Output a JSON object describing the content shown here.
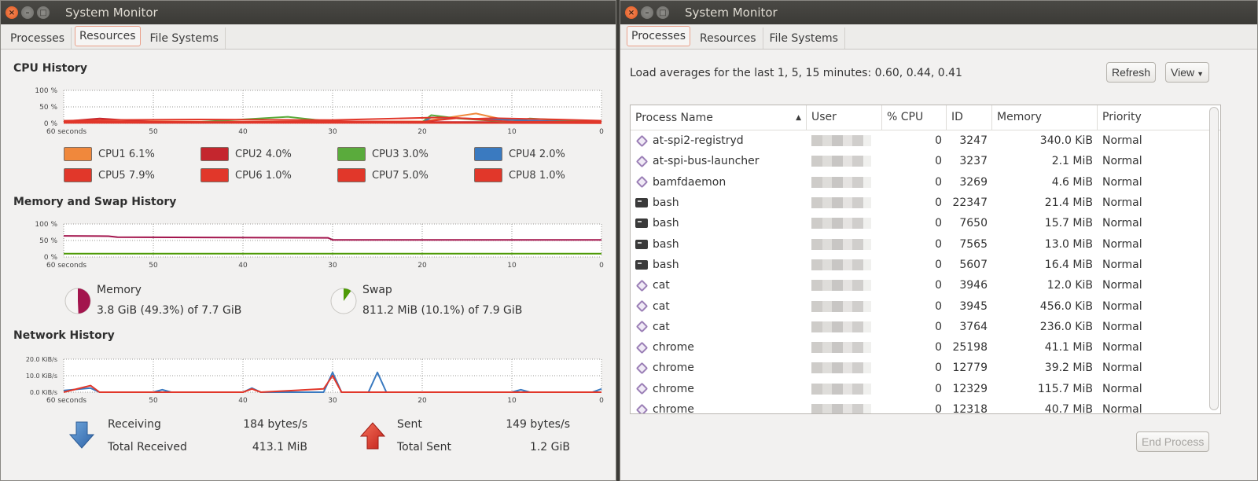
{
  "left_window": {
    "title": "System Monitor",
    "tabs": [
      {
        "label": "Processes",
        "active": false
      },
      {
        "label": "Resources",
        "active": true
      },
      {
        "label": "File Systems",
        "active": false
      }
    ],
    "cpu": {
      "title": "CPU History",
      "legend": [
        {
          "label": "CPU1",
          "value": "6.1%",
          "color": "#f0883c"
        },
        {
          "label": "CPU2",
          "value": "4.0%",
          "color": "#c4262e"
        },
        {
          "label": "CPU3",
          "value": "3.0%",
          "color": "#5aab3c"
        },
        {
          "label": "CPU4",
          "value": "2.0%",
          "color": "#3a7ac0"
        },
        {
          "label": "CPU5",
          "value": "7.9%",
          "color": "#e1372a"
        },
        {
          "label": "CPU6",
          "value": "1.0%",
          "color": "#e1372a"
        },
        {
          "label": "CPU7",
          "value": "5.0%",
          "color": "#e1372a"
        },
        {
          "label": "CPU8",
          "value": "1.0%",
          "color": "#e1372a"
        }
      ]
    },
    "memory": {
      "title": "Memory and Swap History",
      "memory_label": "Memory",
      "memory_value": "3.8 GiB (49.3%) of 7.7 GiB",
      "memory_fraction": 0.493,
      "memory_color": "#a3154d",
      "swap_label": "Swap",
      "swap_value": "811.2 MiB (10.1%) of 7.9 GiB",
      "swap_fraction": 0.101,
      "swap_color": "#4e9a06"
    },
    "network": {
      "title": "Network History",
      "receiving_label": "Receiving",
      "receiving_value": "184 bytes/s",
      "total_received_label": "Total Received",
      "total_received_value": "413.1 MiB",
      "sent_label": "Sent",
      "sent_value": "149 bytes/s",
      "total_sent_label": "Total Sent",
      "total_sent_value": "1.2 GiB",
      "receive_color": "#3a7ac0",
      "sent_color": "#e1372a"
    }
  },
  "chart_data": [
    {
      "type": "line",
      "title": "CPU History",
      "x_ticks": [
        "60 seconds",
        "50",
        "40",
        "30",
        "20",
        "10",
        "0"
      ],
      "y_ticks": [
        "100 %",
        "50 %",
        "0 %"
      ],
      "ylim": [
        0,
        100
      ],
      "x_range": [
        60,
        0
      ],
      "grid": true,
      "series": [
        {
          "name": "CPU1",
          "color": "#f0883c",
          "points": [
            [
              60,
              5
            ],
            [
              50,
              6
            ],
            [
              40,
              5
            ],
            [
              30,
              6
            ],
            [
              20,
              6
            ],
            [
              14,
              30
            ],
            [
              10,
              6
            ],
            [
              5,
              8
            ],
            [
              0,
              6
            ]
          ]
        },
        {
          "name": "CPU2",
          "color": "#c4262e",
          "points": [
            [
              60,
              6
            ],
            [
              56,
              15
            ],
            [
              50,
              4
            ],
            [
              40,
              4
            ],
            [
              30,
              6
            ],
            [
              20,
              4
            ],
            [
              0,
              4
            ]
          ]
        },
        {
          "name": "CPU3",
          "color": "#5aab3c",
          "points": [
            [
              60,
              4
            ],
            [
              50,
              3
            ],
            [
              45,
              4
            ],
            [
              35,
              20
            ],
            [
              30,
              5
            ],
            [
              20,
              4
            ],
            [
              19,
              25
            ],
            [
              16,
              15
            ],
            [
              10,
              4
            ],
            [
              8,
              15
            ],
            [
              0,
              3
            ]
          ]
        },
        {
          "name": "CPU4",
          "color": "#3a7ac0",
          "points": [
            [
              60,
              3
            ],
            [
              50,
              2
            ],
            [
              30,
              3
            ],
            [
              20,
              2
            ],
            [
              19,
              18
            ],
            [
              0,
              2
            ]
          ]
        },
        {
          "name": "CPU5",
          "color": "#e1372a",
          "points": [
            [
              60,
              8
            ],
            [
              56,
              10
            ],
            [
              45,
              12
            ],
            [
              30,
              10
            ],
            [
              18,
              18
            ],
            [
              14,
              14
            ],
            [
              12,
              16
            ],
            [
              5,
              12
            ],
            [
              0,
              8
            ]
          ]
        },
        {
          "name": "CPU6",
          "color": "#e1372a",
          "points": [
            [
              60,
              2
            ],
            [
              30,
              2
            ],
            [
              0,
              1
            ]
          ]
        },
        {
          "name": "CPU7",
          "color": "#e1372a",
          "points": [
            [
              60,
              6
            ],
            [
              50,
              5
            ],
            [
              40,
              4
            ],
            [
              30,
              6
            ],
            [
              20,
              5
            ],
            [
              16,
              16
            ],
            [
              10,
              5
            ],
            [
              0,
              5
            ]
          ]
        },
        {
          "name": "CPU8",
          "color": "#e1372a",
          "points": [
            [
              60,
              2
            ],
            [
              30,
              2
            ],
            [
              0,
              1
            ]
          ]
        }
      ]
    },
    {
      "type": "line",
      "title": "Memory and Swap History",
      "x_ticks": [
        "60 seconds",
        "50",
        "40",
        "30",
        "20",
        "10",
        "0"
      ],
      "y_ticks": [
        "100 %",
        "50 %",
        "0 %"
      ],
      "ylim": [
        0,
        100
      ],
      "x_range": [
        60,
        0
      ],
      "grid": true,
      "series": [
        {
          "name": "Memory",
          "color": "#a3154d",
          "points": [
            [
              60,
              64
            ],
            [
              55,
              63
            ],
            [
              54,
              60
            ],
            [
              30.5,
              58
            ],
            [
              30,
              52
            ],
            [
              0,
              52
            ]
          ]
        },
        {
          "name": "Swap",
          "color": "#4e9a06",
          "points": [
            [
              60,
              10
            ],
            [
              0,
              10
            ]
          ]
        }
      ]
    },
    {
      "type": "line",
      "title": "Network History",
      "x_ticks": [
        "60 seconds",
        "50",
        "40",
        "30",
        "20",
        "10",
        "0"
      ],
      "y_ticks": [
        "20.0 KiB/s",
        "10.0 KiB/s",
        "0.0 KiB/s"
      ],
      "ylim": [
        0,
        20
      ],
      "x_range": [
        60,
        0
      ],
      "grid": true,
      "series": [
        {
          "name": "Receiving",
          "color": "#3a7ac0",
          "points": [
            [
              60,
              1
            ],
            [
              57,
              2.5
            ],
            [
              56,
              0
            ],
            [
              50,
              0
            ],
            [
              49,
              1.5
            ],
            [
              48,
              0
            ],
            [
              40,
              0
            ],
            [
              39,
              2.5
            ],
            [
              38,
              0
            ],
            [
              31,
              0
            ],
            [
              30,
              12
            ],
            [
              29,
              0
            ],
            [
              26,
              0
            ],
            [
              25,
              12
            ],
            [
              24,
              0
            ],
            [
              10,
              0
            ],
            [
              9,
              1.5
            ],
            [
              8,
              0
            ],
            [
              1,
              0
            ],
            [
              0,
              2
            ]
          ]
        },
        {
          "name": "Sent",
          "color": "#e1372a",
          "points": [
            [
              60,
              0
            ],
            [
              57,
              4
            ],
            [
              56,
              0
            ],
            [
              40,
              0
            ],
            [
              39,
              2
            ],
            [
              38,
              0
            ],
            [
              31,
              2
            ],
            [
              30,
              10
            ],
            [
              29,
              0
            ],
            [
              0,
              0
            ]
          ]
        }
      ]
    }
  ],
  "right_window": {
    "title": "System Monitor",
    "tabs": [
      {
        "label": "Processes",
        "active": true
      },
      {
        "label": "Resources",
        "active": false
      },
      {
        "label": "File Systems",
        "active": false
      }
    ],
    "load_averages": "Load averages for the last 1, 5, 15 minutes: 0.60, 0.44, 0.41",
    "refresh_label": "Refresh",
    "view_label": "View",
    "end_process_label": "End Process",
    "columns": [
      "Process Name",
      "User",
      "% CPU",
      "ID",
      "Memory",
      "Priority"
    ],
    "sort_indicator": "▲",
    "rows": [
      {
        "name": "at-spi2-registryd",
        "icon": "generic",
        "cpu": "0",
        "id": "3247",
        "memory": "340.0 KiB",
        "priority": "Normal"
      },
      {
        "name": "at-spi-bus-launcher",
        "icon": "generic",
        "cpu": "0",
        "id": "3237",
        "memory": "2.1 MiB",
        "priority": "Normal"
      },
      {
        "name": "bamfdaemon",
        "icon": "generic",
        "cpu": "0",
        "id": "3269",
        "memory": "4.6 MiB",
        "priority": "Normal"
      },
      {
        "name": "bash",
        "icon": "terminal",
        "cpu": "0",
        "id": "22347",
        "memory": "21.4 MiB",
        "priority": "Normal"
      },
      {
        "name": "bash",
        "icon": "terminal",
        "cpu": "0",
        "id": "7650",
        "memory": "15.7 MiB",
        "priority": "Normal"
      },
      {
        "name": "bash",
        "icon": "terminal",
        "cpu": "0",
        "id": "7565",
        "memory": "13.0 MiB",
        "priority": "Normal"
      },
      {
        "name": "bash",
        "icon": "terminal",
        "cpu": "0",
        "id": "5607",
        "memory": "16.4 MiB",
        "priority": "Normal"
      },
      {
        "name": "cat",
        "icon": "generic",
        "cpu": "0",
        "id": "3946",
        "memory": "12.0 KiB",
        "priority": "Normal"
      },
      {
        "name": "cat",
        "icon": "generic",
        "cpu": "0",
        "id": "3945",
        "memory": "456.0 KiB",
        "priority": "Normal"
      },
      {
        "name": "cat",
        "icon": "generic",
        "cpu": "0",
        "id": "3764",
        "memory": "236.0 KiB",
        "priority": "Normal"
      },
      {
        "name": "chrome",
        "icon": "generic",
        "cpu": "0",
        "id": "25198",
        "memory": "41.1 MiB",
        "priority": "Normal"
      },
      {
        "name": "chrome",
        "icon": "generic",
        "cpu": "0",
        "id": "12779",
        "memory": "39.2 MiB",
        "priority": "Normal"
      },
      {
        "name": "chrome",
        "icon": "generic",
        "cpu": "0",
        "id": "12329",
        "memory": "115.7 MiB",
        "priority": "Normal"
      },
      {
        "name": "chrome",
        "icon": "generic",
        "cpu": "0",
        "id": "12318",
        "memory": "40.7 MiB",
        "priority": "Normal"
      }
    ]
  }
}
